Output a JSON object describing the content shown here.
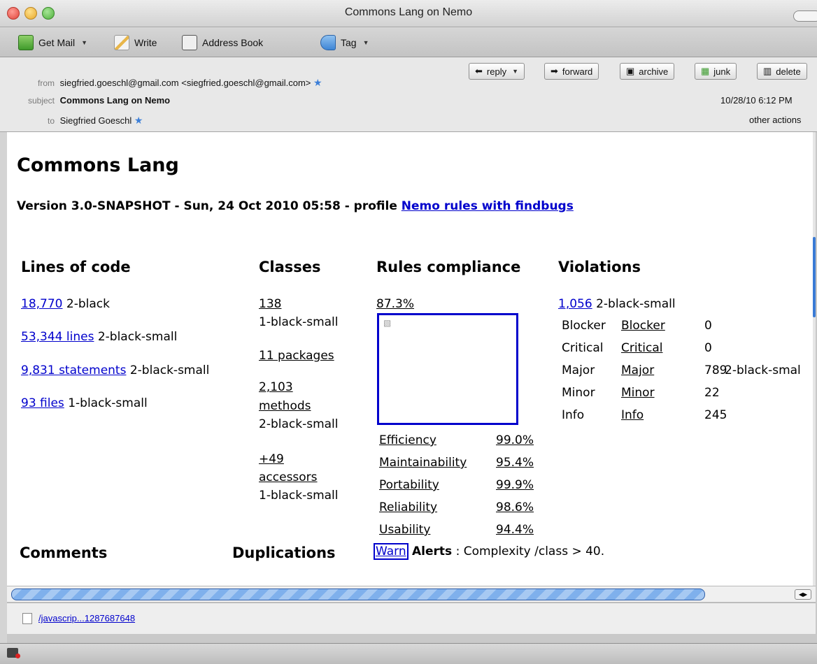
{
  "window": {
    "title": "Commons Lang on Nemo",
    "colors": {
      "close": "#ee5b50",
      "minimize": "#f6be4f",
      "zoom": "#5fc24c"
    }
  },
  "toolbar": {
    "get_mail": "Get Mail",
    "write": "Write",
    "address_book": "Address Book",
    "tag": "Tag"
  },
  "header": {
    "from_label": "from",
    "from_value": "siegfried.goeschl@gmail.com <siegfried.goeschl@gmail.com>",
    "subject_label": "subject",
    "subject_value": "Commons Lang on Nemo",
    "to_label": "to",
    "to_value": "Siegfried Goeschl",
    "date": "10/28/10 6:12 PM",
    "other_actions": "other actions",
    "buttons": {
      "reply": "reply",
      "forward": "forward",
      "archive": "archive",
      "junk": "junk",
      "delete": "delete"
    }
  },
  "report": {
    "title": "Commons Lang",
    "version_line": "Version 3.0-SNAPSHOT - Sun, 24 Oct 2010 05:58 - profile",
    "profile_link": "Nemo rules with findbugs",
    "loc": {
      "heading": "Lines of code",
      "value": "18,770",
      "value_class": "2-black",
      "lines": "53,344 lines",
      "lines_class": "2-black-small",
      "statements": "9,831 statements",
      "statements_class": "2-black-small",
      "files": "93 files",
      "files_class": "1-black-small"
    },
    "classes": {
      "heading": "Classes",
      "value": "138",
      "value_class": "1-black-small",
      "packages": "11 packages",
      "methods_a": "2,103",
      "methods_b": "methods",
      "methods_class": "2-black-small",
      "accessors_a": "+49",
      "accessors_b": "accessors",
      "accessors_class": "1-black-small"
    },
    "rules": {
      "heading": "Rules compliance",
      "value": "87.3%",
      "items": [
        {
          "name": "Efficiency",
          "pct": "99.0%"
        },
        {
          "name": "Maintainability",
          "pct": "95.4%"
        },
        {
          "name": "Portability",
          "pct": "99.9%"
        },
        {
          "name": "Reliability",
          "pct": "98.6%"
        },
        {
          "name": "Usability",
          "pct": "94.4%"
        }
      ]
    },
    "violations": {
      "heading": "Violations",
      "value": "1,056",
      "value_class": "2-black-small",
      "rows": [
        {
          "label": "Blocker",
          "link": "Blocker",
          "count": "0",
          "note": ""
        },
        {
          "label": "Critical",
          "link": "Critical",
          "count": "0",
          "note": ""
        },
        {
          "label": "Major",
          "link": "Major",
          "count": "789",
          "note": "2-black-smal"
        },
        {
          "label": "Minor",
          "link": "Minor",
          "count": "22",
          "note": ""
        },
        {
          "label": "Info",
          "link": "Info",
          "count": "245",
          "note": ""
        }
      ]
    },
    "comments_heading": "Comments",
    "duplications_heading": "Duplications",
    "alert": {
      "badge": "Warn",
      "label": "Alerts",
      "text": ": Complexity /class > 40."
    }
  },
  "attachment": {
    "name": "/javascrip...1287687648"
  }
}
